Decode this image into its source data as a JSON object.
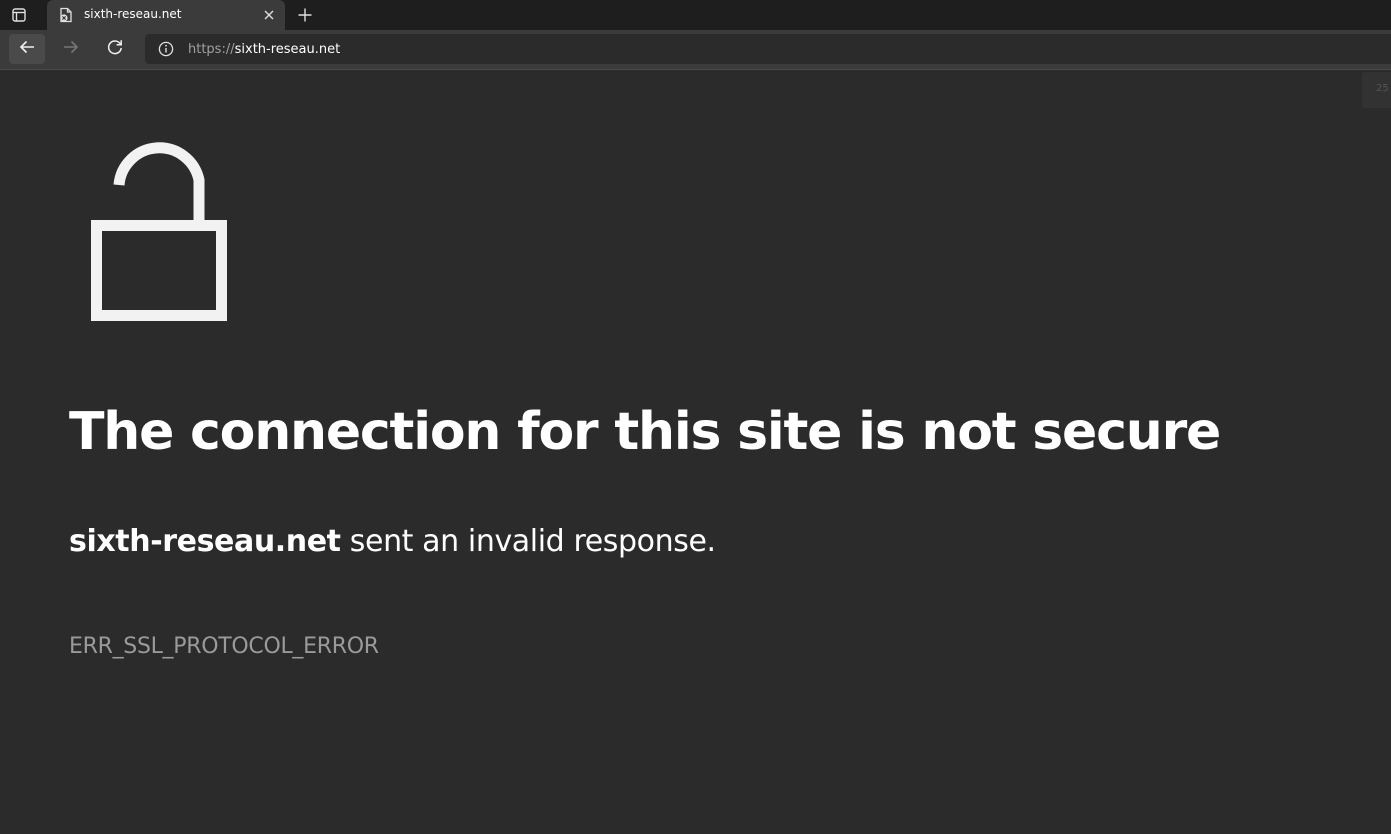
{
  "tab": {
    "title": "sixth-reseau.net"
  },
  "address_bar": {
    "scheme": "https://",
    "host": "sixth-reseau.net"
  },
  "zoom_chip": {
    "text": "25"
  },
  "error_page": {
    "headline": "The connection for this site is not secure",
    "site_name": "sixth-reseau.net",
    "message": " sent an invalid response.",
    "error_code": "ERR_SSL_PROTOCOL_ERROR"
  },
  "icons": {
    "tab_actions": "tab-actions-icon",
    "favicon": "broken-page-icon",
    "close": "close-icon",
    "new_tab": "plus-icon",
    "back": "back-arrow-icon",
    "forward": "forward-arrow-icon",
    "refresh": "refresh-icon",
    "site_info": "info-icon",
    "lock": "unlocked-padlock-icon"
  },
  "colors": {
    "page_background": "#2b2b2b",
    "toolbar": "#3b3b3b",
    "tabstrip": "#1e1e1e",
    "error_code": "#9a9a9a"
  }
}
